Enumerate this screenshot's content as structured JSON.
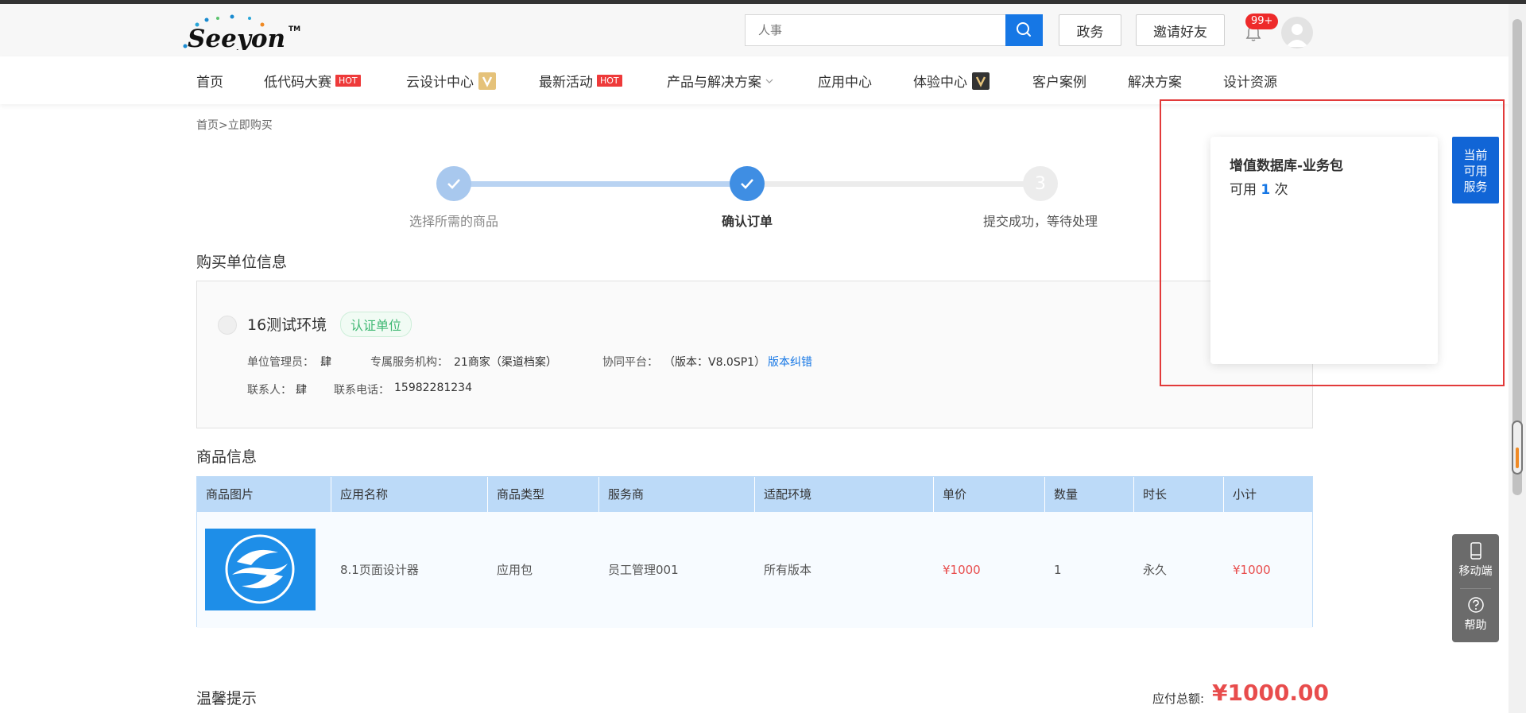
{
  "header": {
    "search_placeholder": "人事",
    "btn_affairs": "政务",
    "btn_invite": "邀请好友",
    "notification_badge": "99+"
  },
  "nav": {
    "items": [
      "首页",
      "低代码大赛",
      "云设计中心",
      "最新活动",
      "产品与解决方案",
      "应用中心",
      "体验中心",
      "客户案例",
      "解决方案",
      "设计资源"
    ],
    "hot": "HOT"
  },
  "breadcrumb": "首页>立即购买",
  "steps": {
    "step1": "选择所需的商品",
    "step2": "确认订单",
    "step3_num": "3",
    "step3": "提交成功，等待处理"
  },
  "buyer": {
    "section_title": "购买单位信息",
    "company_name": "16测试环境",
    "certified": "认证单位",
    "admin_label": "单位管理员：",
    "admin_value": "肆",
    "agency_label": "专属服务机构：",
    "agency_value": "21商家（渠道档案）",
    "platform_label": "协同平台：",
    "platform_value": "（版本：V8.0SP1）",
    "version_fix": "版本纠错",
    "contact_label": "联系人：",
    "contact_value": "肆",
    "phone_label": "联系电话：",
    "phone_value": "15982281234"
  },
  "products": {
    "section_title": "商品信息",
    "columns": [
      "商品图片",
      "应用名称",
      "商品类型",
      "服务商",
      "适配环境",
      "单价",
      "数量",
      "时长",
      "小计"
    ],
    "rows": [
      {
        "name": "8.1页面设计器",
        "type": "应用包",
        "vendor": "员工管理001",
        "env": "所有版本",
        "price": "¥1000",
        "qty": "1",
        "duration": "永久",
        "subtotal": "¥1000"
      }
    ]
  },
  "notice_title": "温馨提示",
  "total": {
    "label": "应付总额:",
    "value": "¥1000.00"
  },
  "popup": {
    "title": "增值数据库-业务包",
    "avail_prefix": "可用",
    "count": "1",
    "avail_suffix": "次"
  },
  "side_button": {
    "line1": "当前",
    "line2": "可用",
    "line3": "服务"
  },
  "tools": {
    "mobile": "移动端",
    "help": "帮助"
  },
  "colors": {
    "brand_blue": "#1677e5",
    "price_red": "#e84c4c",
    "table_header": "#bcdaf8",
    "certified_green": "#3fb873",
    "highlight_red": "#e23a3a"
  }
}
